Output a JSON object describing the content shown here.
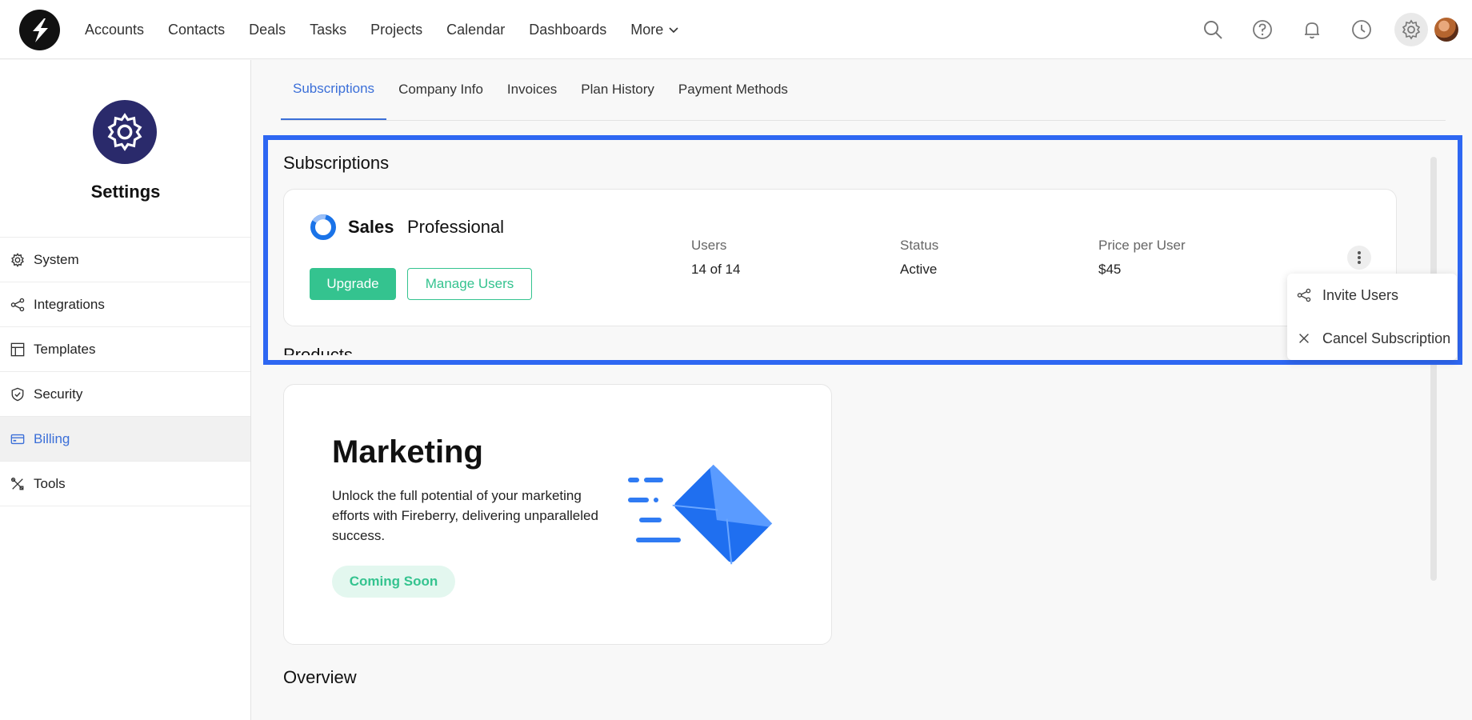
{
  "nav": {
    "items": [
      {
        "label": "Accounts"
      },
      {
        "label": "Contacts"
      },
      {
        "label": "Deals"
      },
      {
        "label": "Tasks"
      },
      {
        "label": "Projects"
      },
      {
        "label": "Calendar"
      },
      {
        "label": "Dashboards"
      }
    ],
    "more_label": "More"
  },
  "sidebar": {
    "title": "Settings",
    "items": [
      {
        "label": "System",
        "icon": "gear-icon"
      },
      {
        "label": "Integrations",
        "icon": "share-icon"
      },
      {
        "label": "Templates",
        "icon": "template-icon"
      },
      {
        "label": "Security",
        "icon": "shield-icon"
      },
      {
        "label": "Billing",
        "icon": "credit-card-icon",
        "active": true
      },
      {
        "label": "Tools",
        "icon": "tools-icon"
      }
    ]
  },
  "tabs": [
    {
      "label": "Subscriptions",
      "active": true
    },
    {
      "label": "Company Info"
    },
    {
      "label": "Invoices"
    },
    {
      "label": "Plan History"
    },
    {
      "label": "Payment Methods"
    }
  ],
  "subscriptions": {
    "title": "Subscriptions",
    "product_name": "Sales",
    "plan": "Professional",
    "upgrade_label": "Upgrade",
    "manage_label": "Manage Users",
    "stats": {
      "users_label": "Users",
      "users_value": "14 of 14",
      "status_label": "Status",
      "status_value": "Active",
      "price_label": "Price per User",
      "price_value": "$45"
    }
  },
  "menu": {
    "invite_label": "Invite Users",
    "cancel_label": "Cancel Subscription"
  },
  "products": {
    "title": "Products",
    "marketing": {
      "title": "Marketing",
      "description": "Unlock the full potential of your marketing efforts with Fireberry, delivering unparalleled success.",
      "badge": "Coming Soon"
    }
  },
  "overview": {
    "title": "Overview"
  },
  "colors": {
    "accent": "#3b6fd8",
    "green": "#34c38f",
    "highlight": "#2e67f2",
    "settings_badge": "#2a2a6b"
  }
}
